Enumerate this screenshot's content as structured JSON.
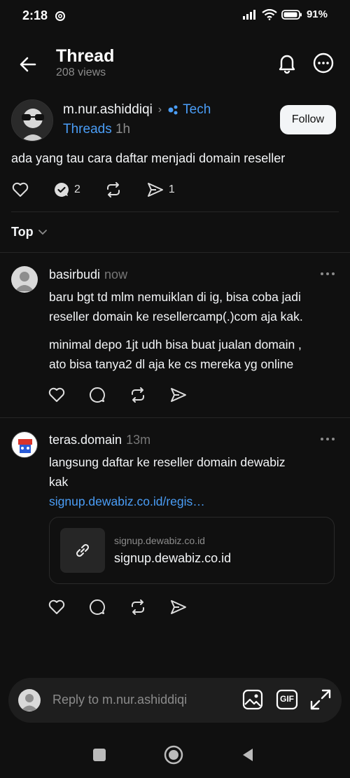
{
  "status": {
    "time": "2:18",
    "battery": "91"
  },
  "header": {
    "title": "Thread",
    "views": "208 views"
  },
  "post": {
    "author": "m.nur.ashiddiqi",
    "topic_part1": "Tech",
    "topic_part2": "Threads",
    "time": "1h",
    "follow_label": "Follow",
    "text": "ada yang tau cara daftar menjadi domain reseller",
    "reply_count": "2",
    "share_count": "1"
  },
  "sort": {
    "label": "Top"
  },
  "replies": [
    {
      "author": "basirbudi",
      "time": "now",
      "lines": [
        "baru bgt td mlm nemuiklan di ig, bisa coba jadi",
        "reseller domain ke resellercamp(.)com aja kak.",
        "minimal depo 1jt udh bisa buat jualan domain ,",
        "ato bisa tanya2 dl aja ke cs mereka yg online"
      ]
    },
    {
      "author": "teras.domain",
      "time": "13m",
      "lines": [
        "langsung daftar ke reseller domain dewabiz",
        "kak"
      ],
      "link": "signup.dewabiz.co.id/regis…",
      "card": {
        "domain": "signup.dewabiz.co.id",
        "title": "signup.dewabiz.co.id"
      }
    }
  ],
  "composer": {
    "placeholder": "Reply to m.nur.ashiddiqi",
    "gif_label": "GIF"
  },
  "colors": {
    "background": "#101010",
    "link": "#4a9df6",
    "muted": "#8b8b8b"
  }
}
